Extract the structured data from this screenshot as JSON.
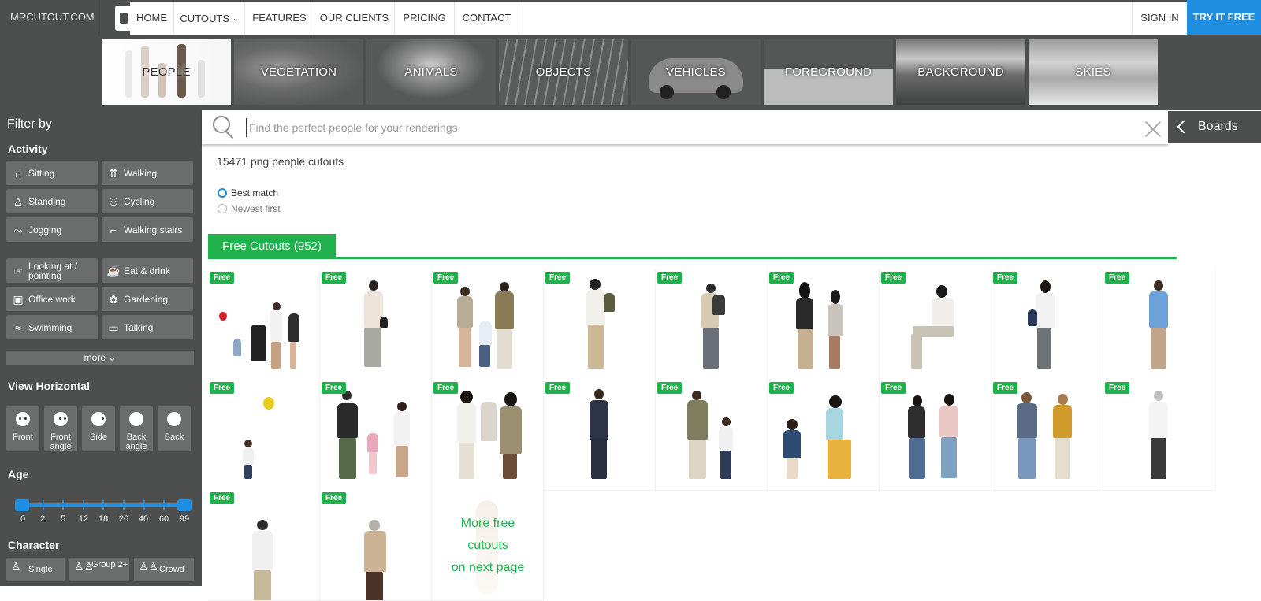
{
  "brand": "MRCUTOUT.COM",
  "nav": {
    "items": [
      "HOME",
      "CUTOUTS",
      "FEATURES",
      "OUR CLIENTS",
      "PRICING",
      "CONTACT"
    ],
    "signin": "SIGN IN",
    "cta": "TRY IT FREE"
  },
  "categories": [
    "PEOPLE",
    "VEGETATION",
    "ANIMALS",
    "OBJECTS",
    "VEHICLES",
    "FOREGROUND",
    "BACKGROUND",
    "SKIES"
  ],
  "sidebar": {
    "title": "Filter by",
    "activity_heading": "Activity",
    "activities": [
      "Sitting",
      "Walking",
      "Standing",
      "Cycling",
      "Jogging",
      "Walking stairs",
      "Looking at / pointing",
      "Eat & drink",
      "Office work",
      "Gardening",
      "Swimming",
      "Talking"
    ],
    "more": "more",
    "view_heading": "View Horizontal",
    "views": [
      "Front",
      "Front angle",
      "Side",
      "Back angle",
      "Back"
    ],
    "age_heading": "Age",
    "age_labels": [
      "0",
      "2",
      "5",
      "12",
      "18",
      "26",
      "40",
      "60",
      "99"
    ],
    "character_heading": "Character",
    "characters": [
      "Single",
      "Group 2+",
      "Crowd"
    ]
  },
  "search": {
    "placeholder": "Find the perfect people for your renderings"
  },
  "boards": "Boards",
  "results": {
    "count": "15471 png people cutouts",
    "sort": [
      "Best match",
      "Newest first"
    ],
    "section": "Free Cutouts (952)",
    "badge": "Free",
    "more_free": [
      "More free",
      "cutouts",
      "on next page"
    ]
  },
  "colors": {
    "accent": "#1f8ee0",
    "green": "#1fb14c",
    "panel": "#4d4f4f"
  }
}
